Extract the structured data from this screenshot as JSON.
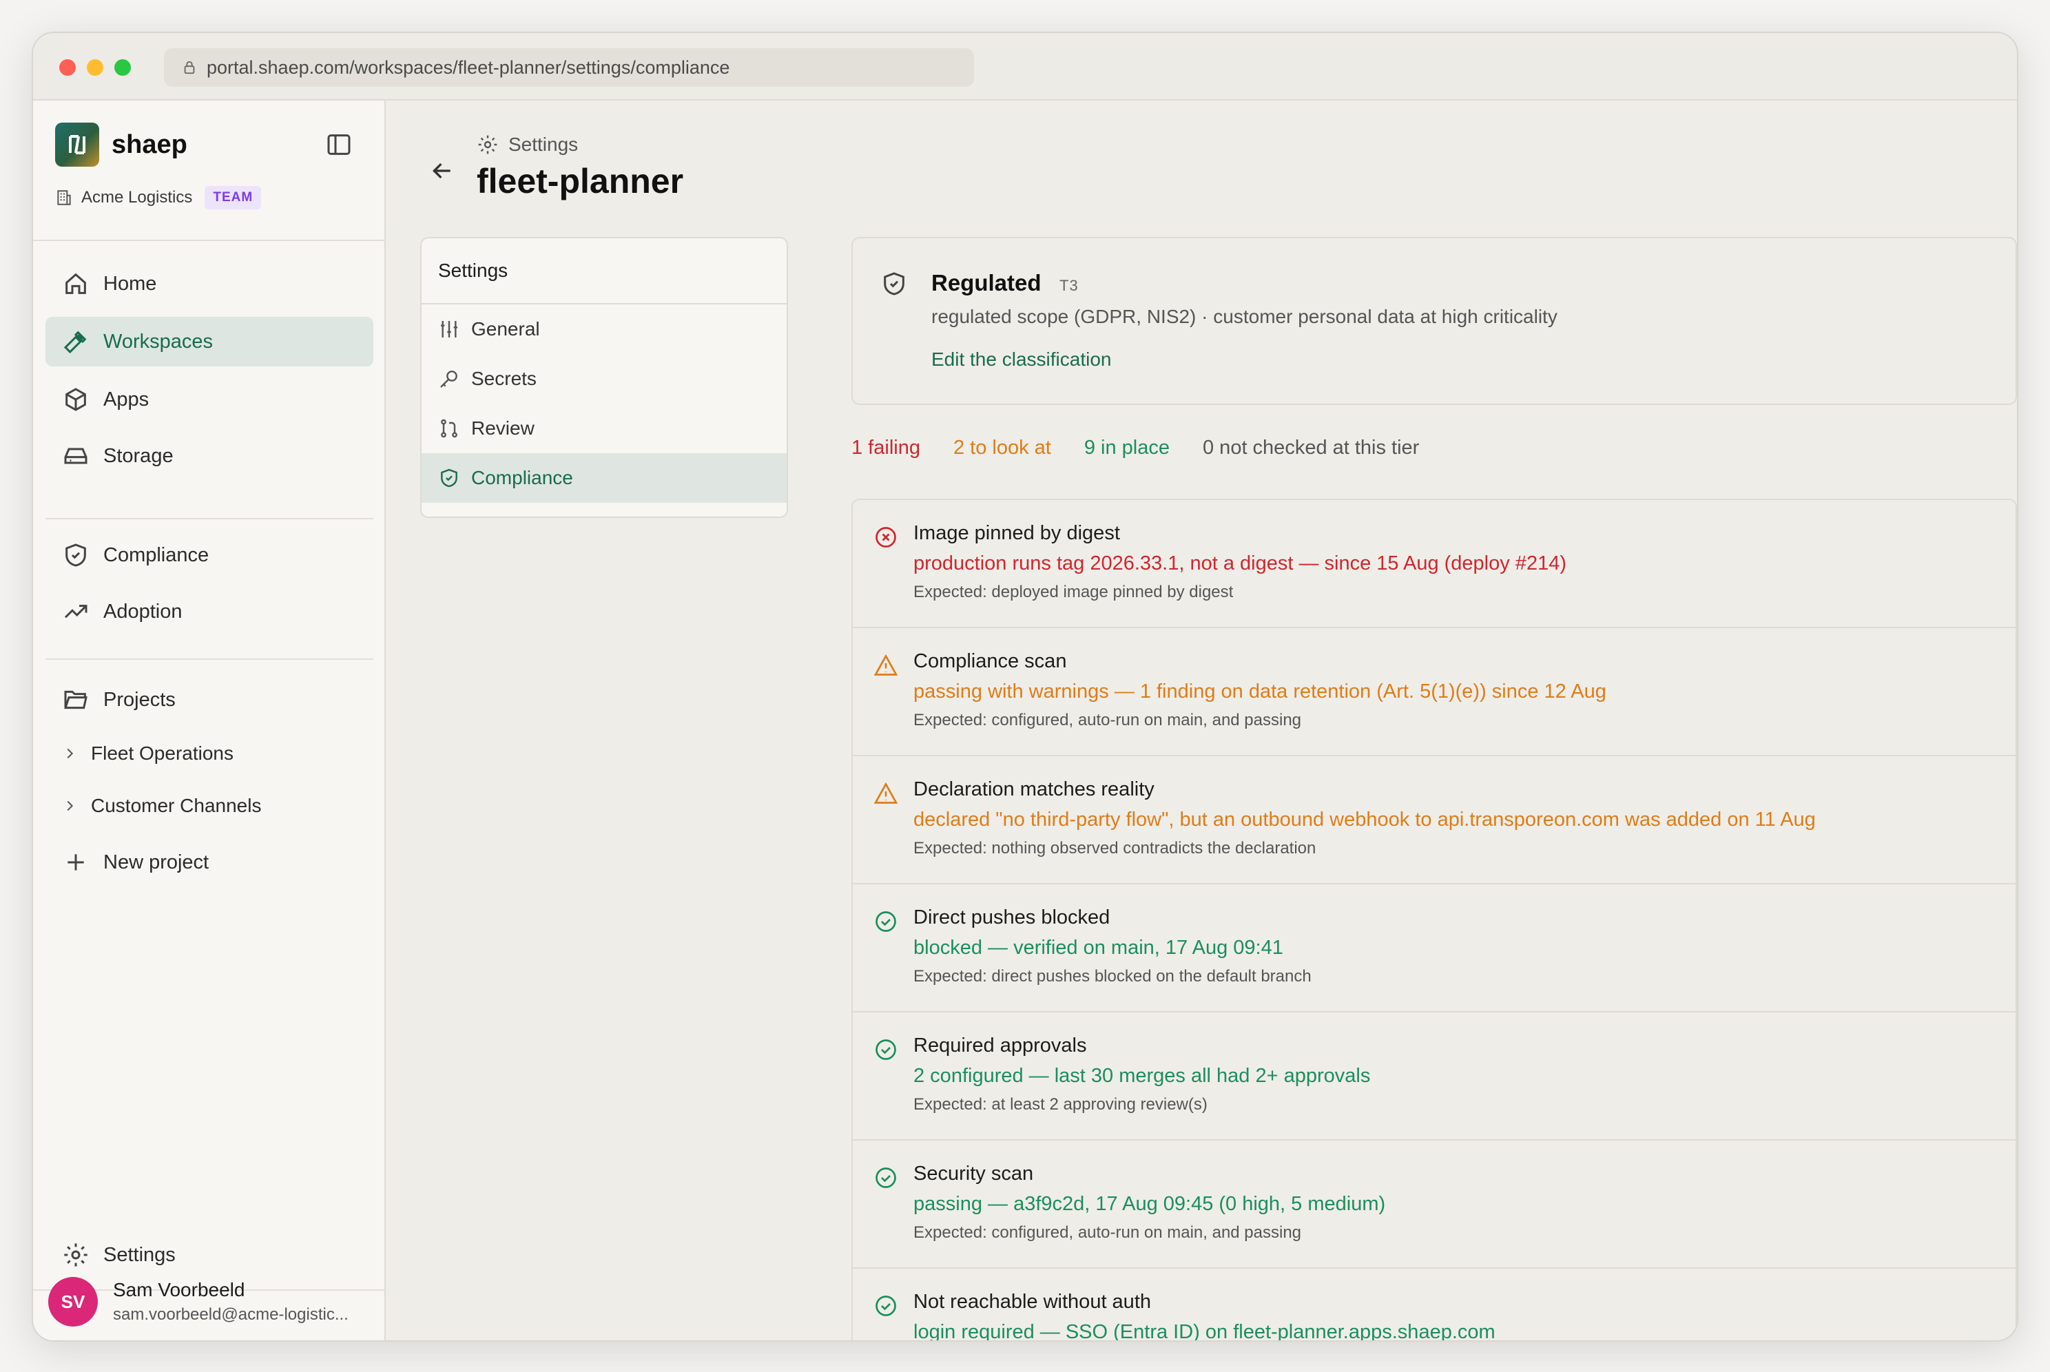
{
  "browser": {
    "url": "portal.shaep.com/workspaces/fleet-planner/settings/compliance"
  },
  "sidebar": {
    "brand": "shaep",
    "org": "Acme Logistics",
    "org_badge": "TEAM",
    "primary_nav": [
      {
        "label": "Home",
        "icon": "home-icon"
      },
      {
        "label": "Workspaces",
        "icon": "hammer-icon",
        "active": true
      },
      {
        "label": "Apps",
        "icon": "cube-icon"
      },
      {
        "label": "Storage",
        "icon": "drive-icon"
      }
    ],
    "secondary_nav": [
      {
        "label": "Compliance",
        "icon": "shield-check-icon"
      },
      {
        "label": "Adoption",
        "icon": "trend-up-icon"
      }
    ],
    "projects_label": "Projects",
    "projects": [
      "Fleet Operations",
      "Customer Channels"
    ],
    "new_project": "New project",
    "settings": "Settings",
    "user": {
      "initials": "SV",
      "name": "Sam Voorbeeld",
      "email": "sam.voorbeeld@acme-logistic..."
    }
  },
  "header": {
    "crumb": "Settings",
    "title": "fleet-planner"
  },
  "settings_nav": {
    "title": "Settings",
    "items": [
      {
        "label": "General",
        "icon": "sliders-icon"
      },
      {
        "label": "Secrets",
        "icon": "key-icon"
      },
      {
        "label": "Review",
        "icon": "git-pull-icon"
      },
      {
        "label": "Compliance",
        "icon": "shield-check-icon",
        "active": true
      }
    ]
  },
  "classification": {
    "title": "Regulated",
    "tier": "T3",
    "description": "regulated scope (GDPR, NIS2) · customer personal data at high criticality",
    "edit_link": "Edit the classification"
  },
  "summary": {
    "failing": "1 failing",
    "warn": "2 to look at",
    "ok": "9 in place",
    "not_checked": "0 not checked at this tier"
  },
  "checks": [
    {
      "status": "fail",
      "title": "Image pinned by digest",
      "detail": "production runs tag 2026.33.1, not a digest — since 15 Aug (deploy #214)",
      "expected": "Expected: deployed image pinned by digest"
    },
    {
      "status": "warn",
      "title": "Compliance scan",
      "detail": "passing with warnings — 1 finding on data retention (Art. 5(1)(e)) since 12 Aug",
      "expected": "Expected: configured, auto-run on main, and passing"
    },
    {
      "status": "warn",
      "title": "Declaration matches reality",
      "detail": "declared \"no third-party flow\", but an outbound webhook to api.transporeon.com was added on 11 Aug",
      "expected": "Expected: nothing observed contradicts the declaration"
    },
    {
      "status": "ok",
      "title": "Direct pushes blocked",
      "detail": "blocked — verified on main, 17 Aug 09:41",
      "expected": "Expected: direct pushes blocked on the default branch"
    },
    {
      "status": "ok",
      "title": "Required approvals",
      "detail": "2 configured — last 30 merges all had 2+ approvals",
      "expected": "Expected: at least 2 approving review(s)"
    },
    {
      "status": "ok",
      "title": "Security scan",
      "detail": "passing — a3f9c2d, 17 Aug 09:45 (0 high, 5 medium)",
      "expected": "Expected: configured, auto-run on main, and passing"
    },
    {
      "status": "ok",
      "title": "Not reachable without auth",
      "detail": "login required — SSO (Entra ID) on fleet-planner.apps.shaep.com",
      "expected": ""
    }
  ],
  "colors": {
    "accent": "#1a6b4e",
    "fail": "#d0262d",
    "warn": "#df7c16",
    "ok": "#1a8f5a"
  }
}
